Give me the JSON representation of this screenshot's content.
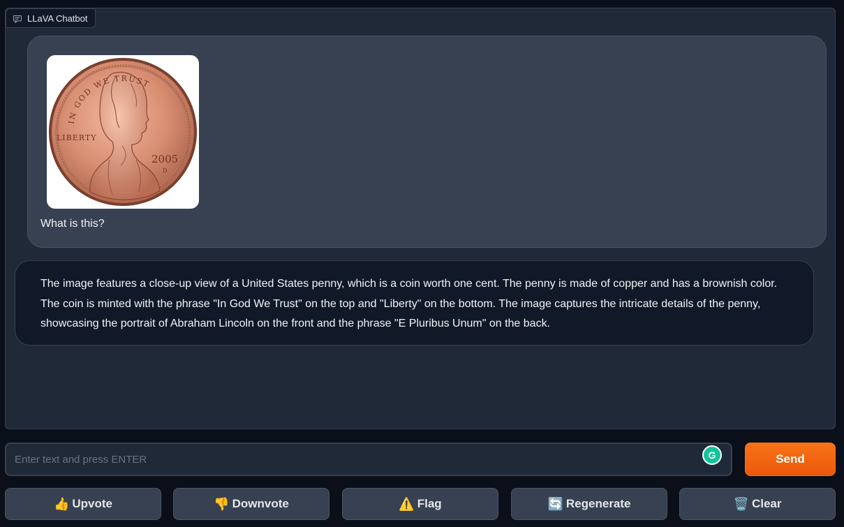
{
  "chatbot": {
    "label": "LLaVA Chatbot",
    "label_icon": "chat-icon"
  },
  "messages": {
    "user": {
      "image_alt": "United States penny",
      "coin_text": {
        "motto": "IN GOD WE TRUST",
        "liberty": "LIBERTY",
        "year": "2005",
        "mint": "D"
      },
      "text": "What is this?"
    },
    "bot": {
      "text": "The image features a close-up view of a United States penny, which is a coin worth one cent. The penny is made of copper and has a brownish color. The coin is minted with the phrase \"In God We Trust\" on the top and \"Liberty\" on the bottom. The image captures the intricate details of the penny, showcasing the portrait of Abraham Lincoln on the front and the phrase \"E Pluribus Unum\" on the back."
    }
  },
  "input": {
    "placeholder": "Enter text and press ENTER",
    "value": "",
    "extension_icon": "grammarly-icon",
    "extension_label": "G"
  },
  "send_button": {
    "label": "Send"
  },
  "actions": {
    "upvote": {
      "emoji": "👍",
      "label": "Upvote"
    },
    "downvote": {
      "emoji": "👎",
      "label": "Downvote"
    },
    "flag": {
      "emoji": "⚠️",
      "label": "Flag"
    },
    "regenerate": {
      "emoji": "🔄",
      "label": "Regenerate"
    },
    "clear": {
      "emoji": "🗑️",
      "label": "Clear"
    }
  },
  "colors": {
    "background": "#0b0f19",
    "panel": "#1f2937",
    "user_bubble": "#374151",
    "bot_bubble": "#111827",
    "accent": "#f97316"
  }
}
